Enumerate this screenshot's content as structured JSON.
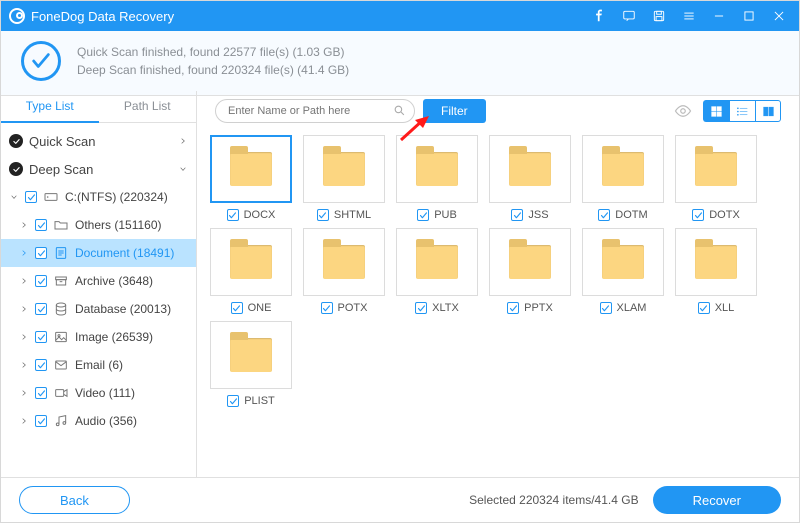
{
  "app": {
    "title": "FoneDog Data Recovery"
  },
  "status": {
    "line1": "Quick Scan finished, found 22577 file(s) (1.03 GB)",
    "line2": "Deep Scan finished, found 220324 file(s) (41.4 GB)"
  },
  "tabs": {
    "type_list": "Type List",
    "path_list": "Path List"
  },
  "tree": {
    "quick_scan": "Quick Scan",
    "deep_scan": "Deep Scan",
    "drive": "C:(NTFS) (220324)",
    "nodes": {
      "others": "Others (151160)",
      "document": "Document (18491)",
      "archive": "Archive (3648)",
      "database": "Database (20013)",
      "image": "Image (26539)",
      "email": "Email (6)",
      "video": "Video (111)",
      "audio": "Audio (356)"
    }
  },
  "toolbar": {
    "search_placeholder": "Enter Name or Path here",
    "filter": "Filter"
  },
  "files": [
    "DOCX",
    "SHTML",
    "PUB",
    "JSS",
    "DOTM",
    "DOTX",
    "ONE",
    "POTX",
    "XLTX",
    "PPTX",
    "XLAM",
    "XLL",
    "PLIST"
  ],
  "footer": {
    "back": "Back",
    "selected": "Selected 220324 items/41.4 GB",
    "recover": "Recover"
  }
}
